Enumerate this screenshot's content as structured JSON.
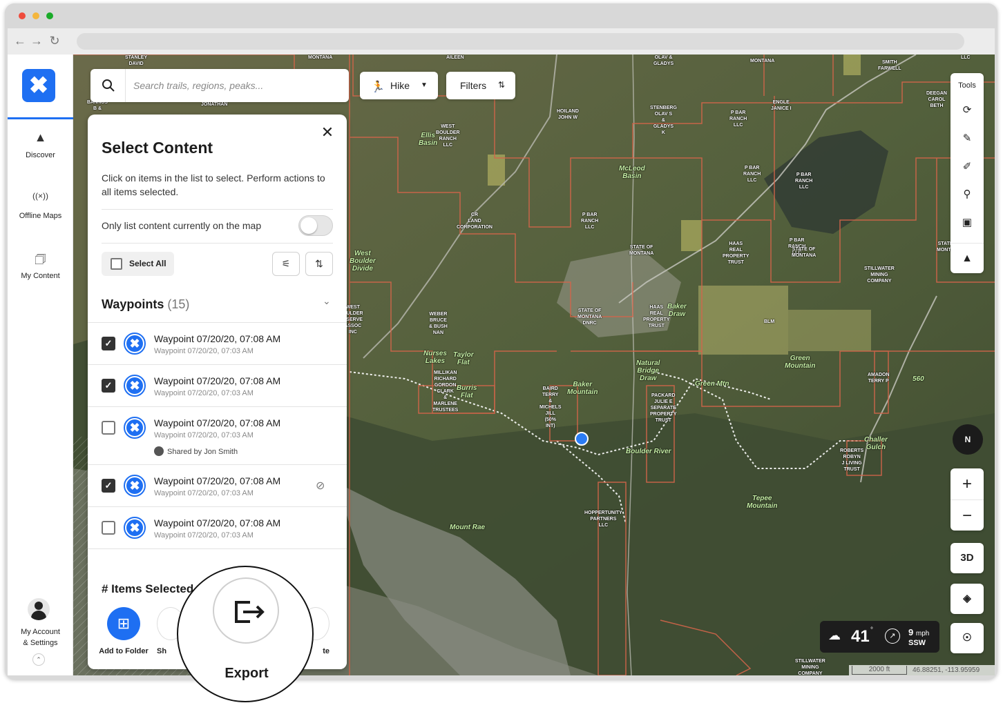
{
  "app": {
    "search_placeholder": "Search trails, regions, peaks...",
    "activity_chip": "Hike",
    "filters_chip": "Filters",
    "accent_color": "#1e6ff2"
  },
  "rail": {
    "items": [
      {
        "label": "Discover",
        "icon": "mountain-icon"
      },
      {
        "label": "Offline Maps",
        "icon": "offline-signal-icon"
      },
      {
        "label": "My Content",
        "icon": "folder-icon"
      }
    ],
    "account_label_1": "My Account",
    "account_label_2": "& Settings"
  },
  "panel": {
    "title": "Select Content",
    "description": "Click on items in the list to select. Perform actions to all items selected.",
    "only_on_map_label": "Only list content currently on the map",
    "only_on_map_enabled": false,
    "select_all_label": "Select All",
    "section_title": "Waypoints",
    "section_count": "(15)",
    "items": [
      {
        "title": "Waypoint 07/20/20, 07:08 AM",
        "subtitle": "Waypoint 07/20/20, 07:03 AM",
        "checked": true,
        "shared": "",
        "hidden": false
      },
      {
        "title": "Waypoint 07/20/20, 07:08 AM",
        "subtitle": "Waypoint 07/20/20, 07:03 AM",
        "checked": true,
        "shared": "",
        "hidden": false
      },
      {
        "title": "Waypoint 07/20/20, 07:08 AM",
        "subtitle": "Waypoint 07/20/20, 07:03 AM",
        "checked": false,
        "shared": "Shared by Jon Smith",
        "hidden": false
      },
      {
        "title": "Waypoint 07/20/20, 07:08 AM",
        "subtitle": "Waypoint 07/20/20, 07:03 AM",
        "checked": true,
        "shared": "",
        "hidden": true
      },
      {
        "title": "Waypoint 07/20/20, 07:08 AM",
        "subtitle": "Waypoint 07/20/20, 07:03 AM",
        "checked": false,
        "shared": "",
        "hidden": false
      }
    ],
    "items_selected_label": "# Items Selected",
    "actions": {
      "add_to_folder": "Add to Folder",
      "share_partial": "Sh",
      "delete_partial": "te",
      "export": "Export"
    }
  },
  "map_controls": {
    "tools_label": "Tools",
    "compass": "N",
    "three_d": "3D",
    "temperature": "41",
    "temp_unit": "°",
    "wind_speed": "9",
    "wind_unit": "mph",
    "wind_dir": "SSW",
    "scale": "2000 ft",
    "coordinates": "46.88251, -113.95959"
  },
  "map_labels": [
    "STANLEY\nDAVID",
    "MONTANA",
    "AILEEN",
    "OLAV &\nGLADYS",
    "MONTANA",
    "SMITH\nFARWELL",
    "LLC",
    "BANNUS\nB &",
    "JONATHAN",
    "HOILAND\nJOHN W",
    "STENBERG\nOLAV S\n&\nGLADYS\nK",
    "P BAR\nRANCH\nLLC",
    "ENGLE\nJANICE I",
    "DEEGAN\nCAROL\nBETH",
    "WEST\nBOULDER\nRANCH\nLLC",
    "P BAR\nRANCH\nLLC",
    "P BAR\nRANCH\nLLC",
    "P BAR\nRANCH\nLLC",
    "CR\nLAND\nCORPORATION",
    "P BAR\nRANCH\nLLC",
    "STATE OF\nMONTANA",
    "HAAS\nREAL\nPROPERTY\nTRUST",
    "STATE OF\nMONTANA",
    "STATE\nMONTA",
    "STILLWATER\nMINING\nCOMPANY",
    "WEST\nOULDER\nESERVE\nASSOC\nINC",
    "WEBER\nBRUCE\n& BUSH\nNAN",
    "STATE OF\nMONTANA\nDNRC",
    "HAAS\nREAL\nPROPERTY\nTRUST",
    "BLM",
    "MILLIKAN\nRICHARD\nGORDON\nCLARK\n&\nMARLENE\nTRUSTEES",
    "BAIRD\nTERRY\n&\nMICHELS\nJILL\n(50%\nINT)",
    "PACKARD\nJULIE E\nSEPARATE\nPROPERTY\nTRUST",
    "AMADON\nTERRY P",
    "ROBERTS\nROBYN\nJ LIVING\nTRUST",
    "HOPPERTUNITY\nPARTNERS\nLLC",
    "STILLWATER\nMINING\nCOMPANY"
  ],
  "map_place_labels": [
    "Ellis\nBasin",
    "McLeod\nBasin",
    "West\nBoulder\nDivide",
    "Taylor\nFlat",
    "Nurses\nLakes",
    "Burris\nFlat",
    "Baker\nDraw",
    "Natural\nBridge\nDraw",
    "Green\nMountain",
    "Baker\nMountain",
    "Tepee\nMountain",
    "Mount Rae",
    "Boulder River",
    "Green Mtn",
    "Challer\nGulch",
    "560"
  ]
}
